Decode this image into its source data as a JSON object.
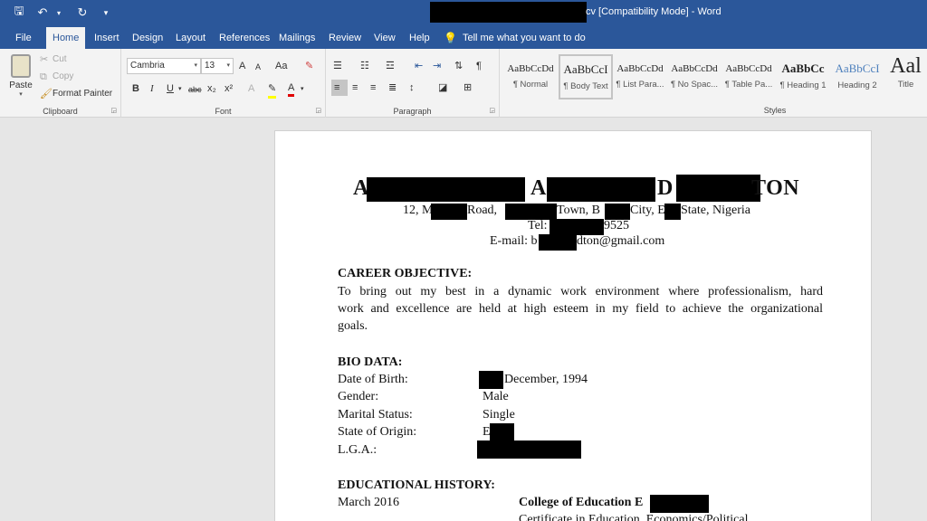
{
  "window": {
    "title_suffix": "cv [Compatibility Mode]  -  Word"
  },
  "qat": {
    "save": "🖫",
    "undo": "↶",
    "redo": "↻",
    "customize": "▾"
  },
  "tabs": [
    "File",
    "Home",
    "Insert",
    "Design",
    "Layout",
    "References",
    "Mailings",
    "Review",
    "View",
    "Help"
  ],
  "active_tab": "Home",
  "tell_me": "Tell me what you want to do",
  "clipboard": {
    "paste": "Paste",
    "cut": "Cut",
    "copy": "Copy",
    "format_painter": "Format Painter",
    "label": "Clipboard"
  },
  "font": {
    "family": "Cambria",
    "size": "13",
    "label": "Font",
    "grow": "A",
    "shrink": "A",
    "change_case": "Aa",
    "bold": "B",
    "italic": "I",
    "underline": "U",
    "strike": "abc",
    "subscript": "x₂",
    "superscript": "x²",
    "font_color": "A"
  },
  "paragraph": {
    "label": "Paragraph"
  },
  "styles": {
    "label": "Styles",
    "items": [
      {
        "preview": "AaBbCcDd",
        "name": "¶ Normal"
      },
      {
        "preview": "AaBbCcI",
        "name": "¶ Body Text"
      },
      {
        "preview": "AaBbCcDd",
        "name": "¶ List Para..."
      },
      {
        "preview": "AaBbCcDd",
        "name": "¶ No Spac..."
      },
      {
        "preview": "AaBbCcDd",
        "name": "¶ Table Pa..."
      },
      {
        "preview": "AaBbCc",
        "name": "¶ Heading 1"
      },
      {
        "preview": "AaBbCcI",
        "name": "Heading 2"
      },
      {
        "preview": "Aal",
        "name": "Title"
      }
    ]
  },
  "document": {
    "name_parts": [
      "A",
      "A",
      "D",
      "TON"
    ],
    "address_parts": [
      "12, M",
      "Road, ",
      "Town, B",
      "City, E",
      "State, Nigeria"
    ],
    "tel_prefix": "Tel:",
    "tel_suffix": "9525",
    "email_prefix": "E-mail: b",
    "email_suffix": "dton@gmail.com",
    "career_heading": "CAREER OBJECTIVE:",
    "career_lines": [
      "To bring out my best in a dynamic work environment where professionalism, hard",
      "work and excellence are held at high esteem in my field to achieve the organizational",
      "goals."
    ],
    "bio_heading": "BIO DATA:",
    "bio": [
      {
        "label": "Date of Birth:",
        "value": "December, 1994"
      },
      {
        "label": "Gender:",
        "value": "Male"
      },
      {
        "label": "Marital Status:",
        "value": "Single"
      },
      {
        "label": "State of Origin:",
        "value": "E"
      },
      {
        "label": "L.G.A.:",
        "value": ""
      }
    ],
    "edu_heading": "EDUCATIONAL HISTORY:",
    "edu_date": "March 2016",
    "edu_school": "College of Education E",
    "edu_cert": "Certificate in Education, Economics/Political"
  }
}
